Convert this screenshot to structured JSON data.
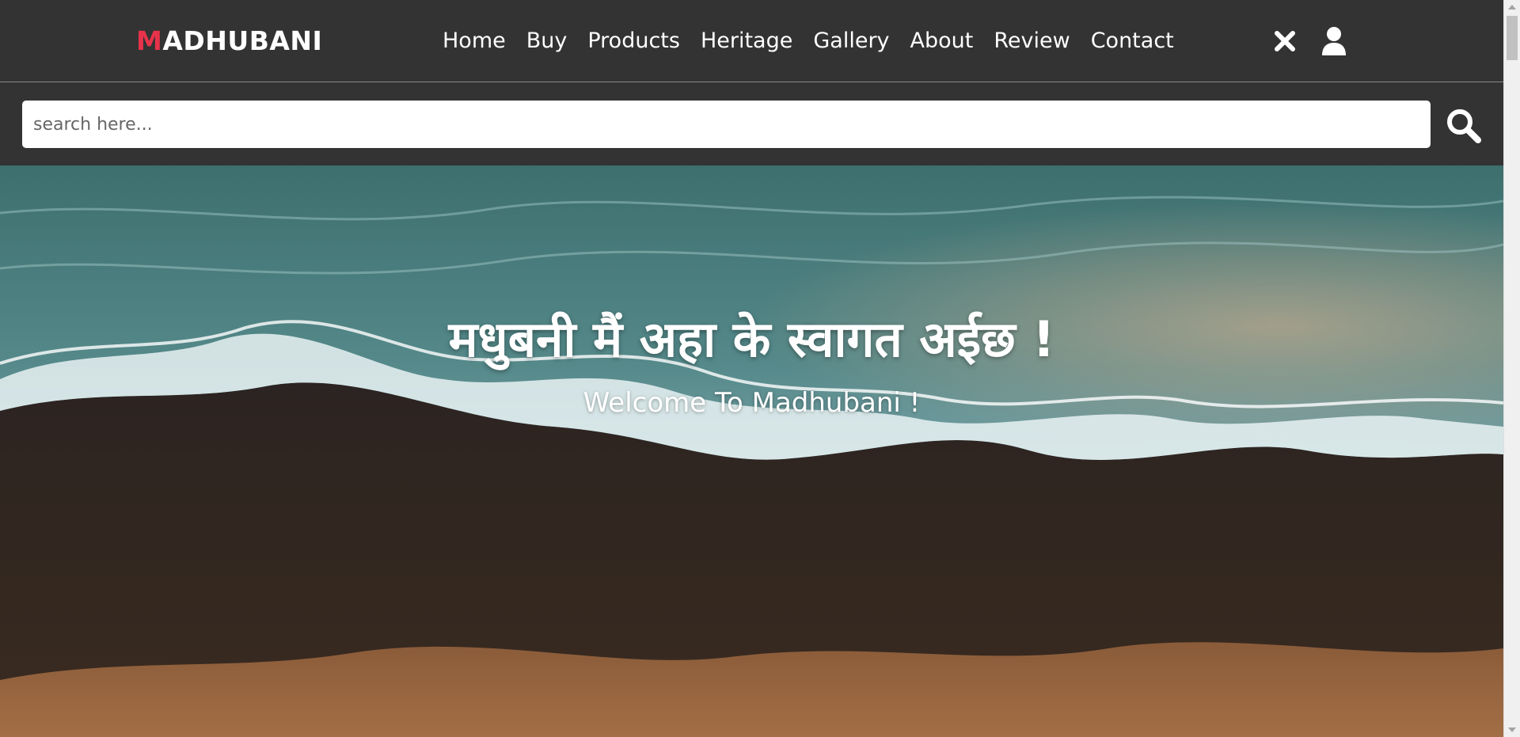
{
  "header": {
    "logo_first_letter": "M",
    "logo_rest": "ADHUBANI",
    "nav": [
      "Home",
      "Buy",
      "Products",
      "Heritage",
      "Gallery",
      "About",
      "Review",
      "Contact"
    ],
    "icons": [
      "close-icon",
      "user-icon"
    ]
  },
  "search": {
    "placeholder": "search here...",
    "value": "",
    "button_icon": "search-icon"
  },
  "hero": {
    "title": "मधुबनी मैं अहा के स्वागत अईछ !",
    "subtitle": "Welcome To Madhubani !"
  },
  "colors": {
    "header_bg": "#333333",
    "logo_accent": "#e8324b",
    "text": "#ffffff"
  }
}
